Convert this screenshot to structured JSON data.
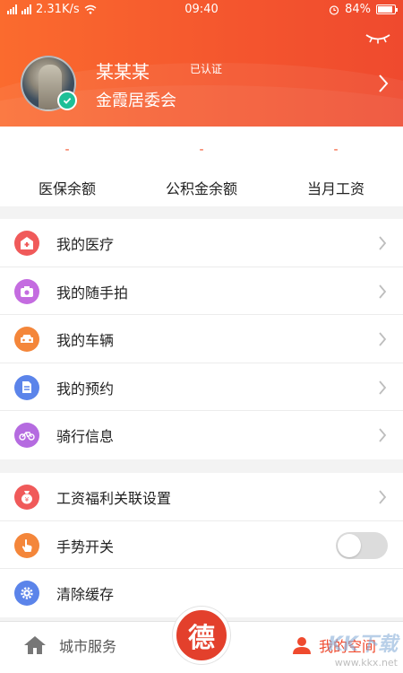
{
  "status_bar": {
    "network_speed": "2.31K/s",
    "time": "09:40",
    "battery": "84%"
  },
  "profile": {
    "name": "某某某",
    "verified_tag": "已认证",
    "organization": "金霞居委会"
  },
  "stats": [
    {
      "value": "-",
      "label": "医保余额"
    },
    {
      "value": "-",
      "label": "公积金余额"
    },
    {
      "value": "-",
      "label": "当月工资"
    }
  ],
  "menu_group1": [
    {
      "label": "我的医疗",
      "icon": "medical-icon",
      "color": "#f05a5a"
    },
    {
      "label": "我的随手拍",
      "icon": "camera-icon",
      "color": "#c46ce0"
    },
    {
      "label": "我的车辆",
      "icon": "car-icon",
      "color": "#f4863a"
    },
    {
      "label": "我的预约",
      "icon": "document-icon",
      "color": "#5b84ea"
    },
    {
      "label": "骑行信息",
      "icon": "bicycle-icon",
      "color": "#b56be0"
    }
  ],
  "menu_group2": [
    {
      "label": "工资福利关联设置",
      "icon": "money-bag-icon",
      "color": "#f05a5a"
    },
    {
      "label": "手势开关",
      "icon": "hand-icon",
      "color": "#f4863a",
      "toggle": false
    },
    {
      "label": "清除缓存",
      "icon": "gear-icon",
      "color": "#5b84ea"
    }
  ],
  "tabbar": {
    "city_service": "城市服务",
    "center_char": "德",
    "my_space": "我的空间"
  },
  "watermark": {
    "brand": "KK下载",
    "url": "www.kkx.net"
  },
  "colors": {
    "header_start": "#fb6b2e",
    "header_end": "#ef4a2e",
    "accent": "#ef4a2e",
    "verified": "#1dbf97"
  }
}
